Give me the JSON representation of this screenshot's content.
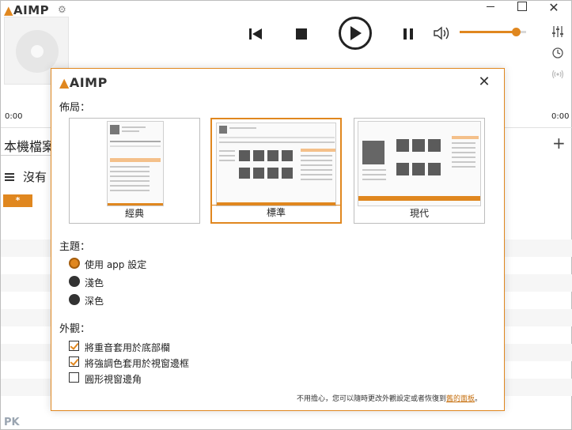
{
  "app": {
    "logo_text": "AIMP",
    "time_elapsed": "0:00",
    "time_total": "0:00",
    "tab_label": "本機檔案",
    "empty_text": "沒有",
    "chip_text": "*",
    "volume_level": 0.85,
    "watermark": "PK"
  },
  "dialog": {
    "logo_text": "AIMP",
    "layout_heading": "佈局：",
    "layouts": [
      {
        "label": "經典",
        "selected": false
      },
      {
        "label": "標準",
        "selected": true
      },
      {
        "label": "現代",
        "selected": false
      }
    ],
    "theme_heading": "主題：",
    "themes": [
      {
        "label": "使用 app 設定",
        "selected": true
      },
      {
        "label": "淺色",
        "selected": false
      },
      {
        "label": "深色",
        "selected": false
      }
    ],
    "appearance_heading": "外觀：",
    "appearance": [
      {
        "label": "將重音套用於底部欄",
        "checked": true
      },
      {
        "label": "將強調色套用於視窗邊框",
        "checked": true
      },
      {
        "label": "圓形視窗邊角",
        "checked": false
      }
    ],
    "footer_text": "不用擔心，您可以隨時更改外觀設定或者恢復到",
    "footer_link": "舊的面板",
    "footer_end": "。"
  },
  "colors": {
    "accent": "#e0871f"
  }
}
